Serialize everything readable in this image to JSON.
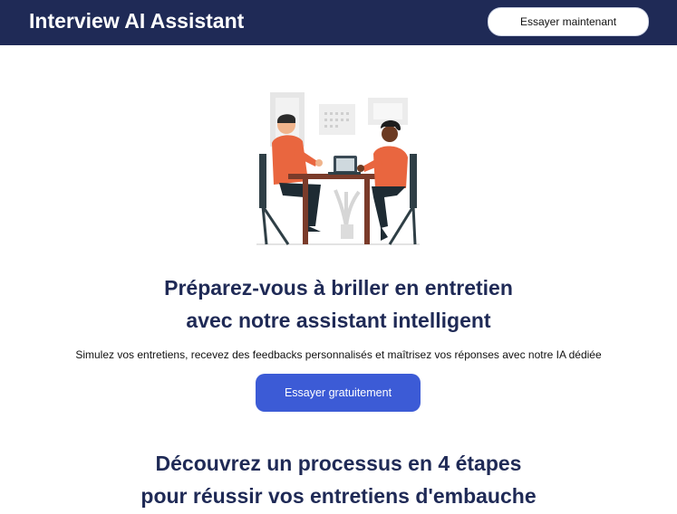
{
  "header": {
    "brand": "Interview AI Assistant",
    "cta_label": "Essayer maintenant"
  },
  "hero": {
    "illustration": "interview-meeting-illustration",
    "title_line1": "Préparez-vous à briller en entretien",
    "title_line2": "avec notre assistant intelligent",
    "subtitle": "Simulez vos entretiens, recevez des feedbacks personnalisés et maîtrisez vos réponses avec notre IA dédiée",
    "cta_label": "Essayer gratuitement"
  },
  "process": {
    "title_line1": "Découvrez un processus en 4 étapes",
    "title_line2": "pour réussir vos entretiens d'embauche"
  },
  "colors": {
    "navy": "#1f2a56",
    "accent_blue": "#3c5bd6",
    "illustration_orange": "#e9663f"
  }
}
